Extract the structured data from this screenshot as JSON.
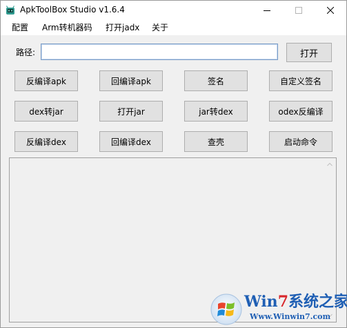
{
  "window": {
    "title": "ApkToolBox Studio v1.6.4"
  },
  "menu": {
    "items": [
      "配置",
      "Arm转机器码",
      "打开jadx",
      "关于"
    ]
  },
  "path": {
    "label": "路径:",
    "value": "",
    "open_button": "打开"
  },
  "buttons": [
    [
      "反编译apk",
      "回编译apk",
      "签名",
      "自定义签名"
    ],
    [
      "dex转jar",
      "打开jar",
      "jar转dex",
      "odex反编译"
    ],
    [
      "反编译dex",
      "回编译dex",
      "查壳",
      "启动命令"
    ]
  ],
  "output": {
    "text": ""
  },
  "watermark": {
    "brand_w": "W",
    "brand_in": "in",
    "brand_7": "7",
    "brand_cn": "系统之家",
    "url": "Www.Winwin7.com"
  },
  "colors": {
    "button_face": "#e1e1e1",
    "button_border": "#adadad",
    "window_bg": "#f0f0f0",
    "input_border": "#7a9cc6",
    "watermark_blue": "#1f5fb4",
    "watermark_red": "#d8262b"
  }
}
